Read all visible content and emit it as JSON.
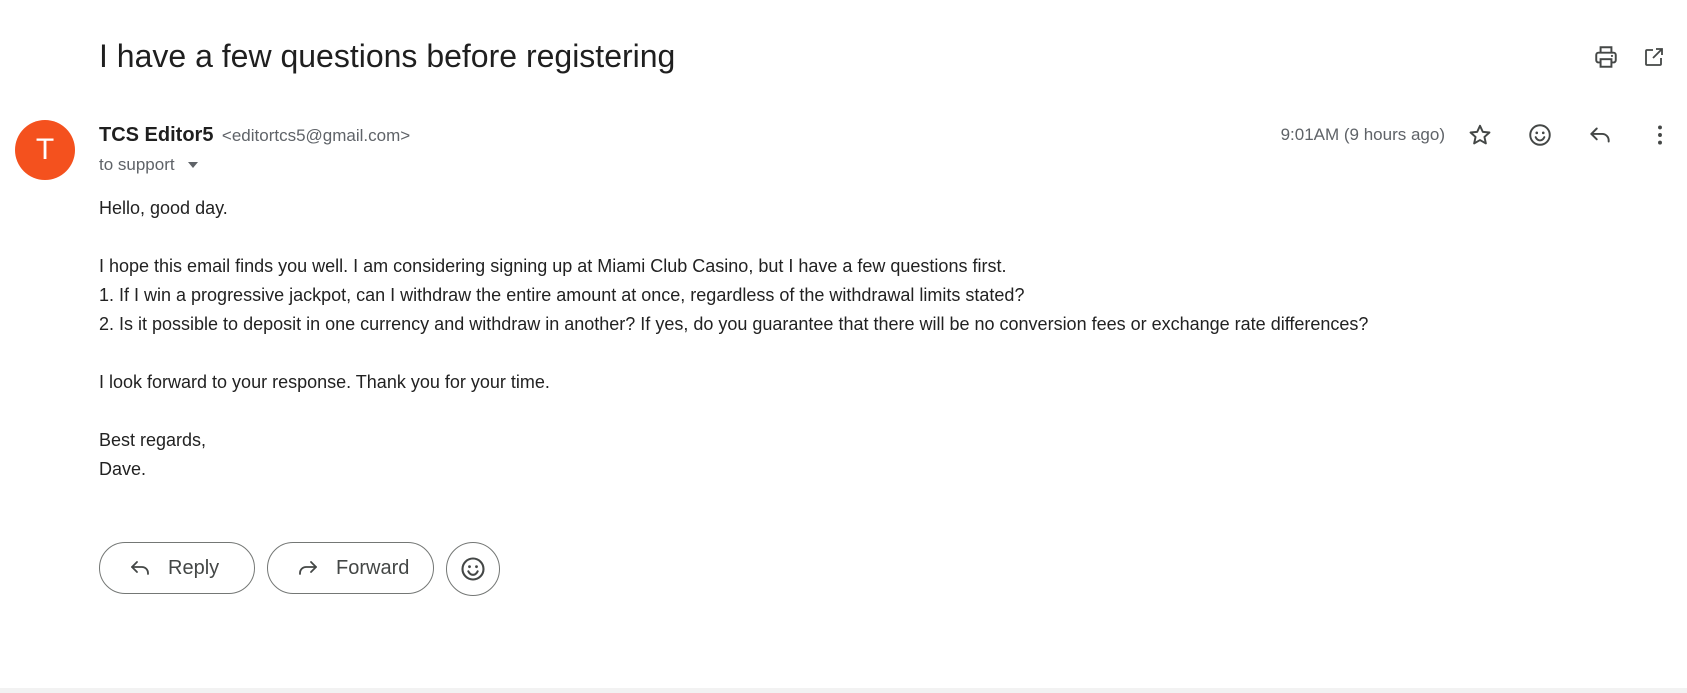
{
  "email": {
    "subject": "I have a few questions before registering",
    "sender": {
      "avatar_letter": "T",
      "avatar_color": "#f4511e",
      "name": "TCS Editor5",
      "email": "<editortcs5@gmail.com>"
    },
    "recipient_text": "to support",
    "timestamp": "9:01AM (9 hours ago)",
    "body": {
      "greeting": "Hello, good day.",
      "line1": "I hope this email finds you well. I am considering signing up at Miami Club Casino, but I have a few questions first.",
      "line2": "1. If I win a progressive jackpot, can I withdraw the entire amount at once, regardless of the withdrawal limits stated?",
      "line3": "2. Is it possible to deposit in one currency and withdraw in another? If yes, do you guarantee that there will be no conversion fees or exchange rate differences?",
      "closing": "I look forward to your response. Thank you for your time.",
      "signoff": "Best regards,",
      "signature": "Dave."
    }
  },
  "toolbar": {
    "print_icon": "print-icon",
    "open_new_window_icon": "open-in-new-window-icon"
  },
  "message_actions": {
    "star_icon": "star-icon",
    "emoji_icon": "emoji-reaction-icon",
    "reply_icon": "reply-icon",
    "more_icon": "more-vertical-icon"
  },
  "bottom_actions": {
    "reply_label": "Reply",
    "forward_label": "Forward"
  }
}
